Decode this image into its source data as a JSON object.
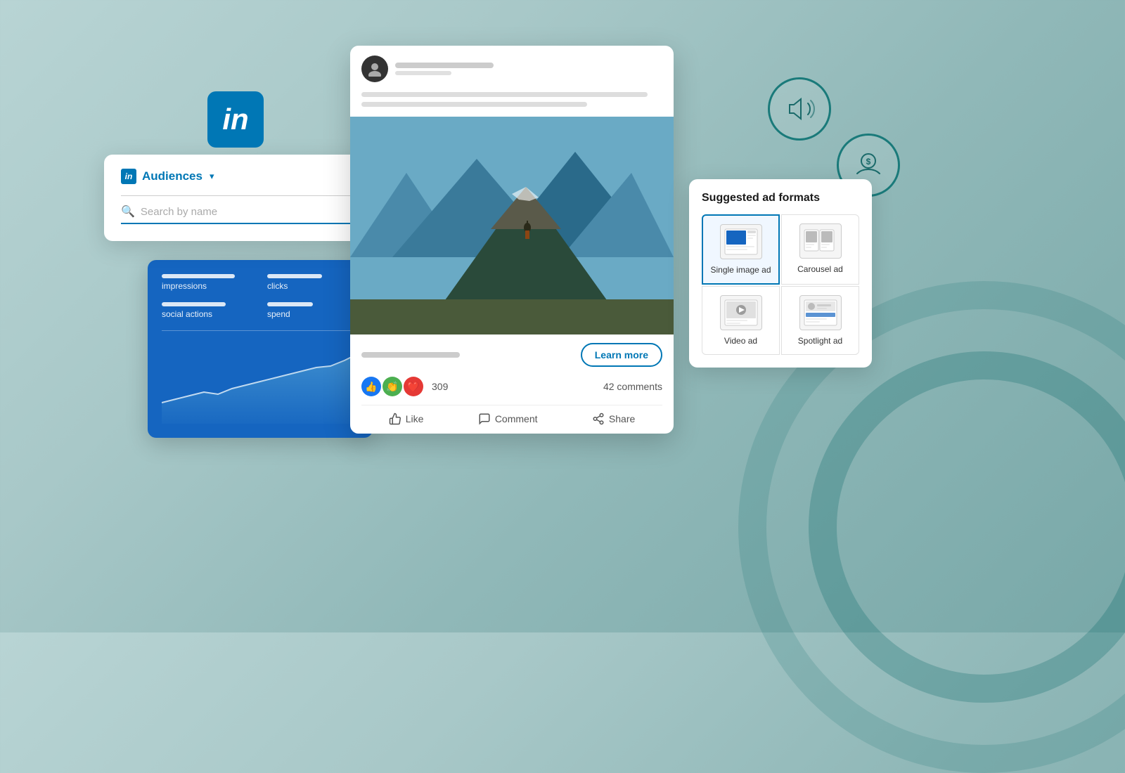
{
  "background": {
    "color_start": "#b8d4d4",
    "color_end": "#78a8a8"
  },
  "linkedin_logo": {
    "text": "in"
  },
  "audiences_panel": {
    "logo_text": "in",
    "title": "Audiences",
    "dropdown_char": "▾",
    "search_placeholder": "Search by name"
  },
  "stats_panel": {
    "labels": [
      "impressions",
      "clicks",
      "social actions",
      "spend"
    ]
  },
  "post_card": {
    "learn_more_label": "Learn more",
    "reaction_count": "309",
    "comments_count": "42 comments",
    "like_label": "Like",
    "comment_label": "Comment",
    "share_label": "Share"
  },
  "ad_formats_panel": {
    "title": "Suggested ad formats",
    "formats": [
      {
        "label": "Single image ad",
        "selected": true
      },
      {
        "label": "Carousel ad",
        "selected": false
      },
      {
        "label": "Video ad",
        "selected": false
      },
      {
        "label": "Spotlight ad",
        "selected": false
      }
    ]
  }
}
